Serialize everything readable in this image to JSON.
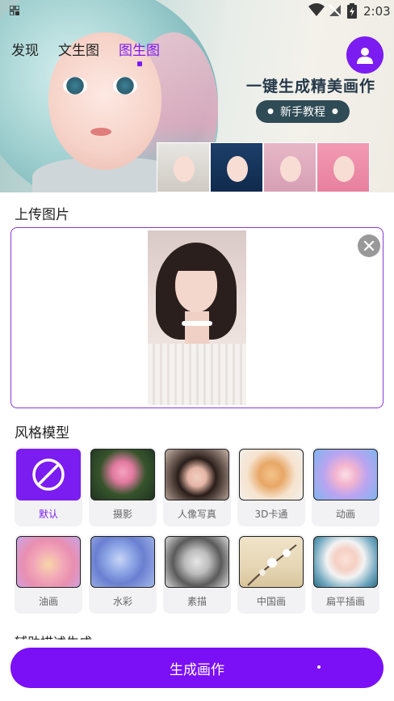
{
  "status_bar": {
    "time": "2:03"
  },
  "tabs": [
    {
      "label": "发现",
      "active": false
    },
    {
      "label": "文生图",
      "active": false
    },
    {
      "label": "图生图",
      "active": true
    }
  ],
  "banner": {
    "slogan": "一键生成精美画作",
    "tutorial_label": "新手教程"
  },
  "upload": {
    "title": "上传图片"
  },
  "styles_section": {
    "title": "风格模型",
    "items": [
      {
        "label": "默认",
        "selected": true,
        "icon": "ban-icon"
      },
      {
        "label": "摄影",
        "selected": false,
        "icon": "lotus-photo"
      },
      {
        "label": "人像写真",
        "selected": false,
        "icon": "portrait-photo"
      },
      {
        "label": "3D卡通",
        "selected": false,
        "icon": "hamster-3d"
      },
      {
        "label": "动画",
        "selected": false,
        "icon": "anime-girl"
      },
      {
        "label": "油画",
        "selected": false,
        "icon": "cat-oil"
      },
      {
        "label": "水彩",
        "selected": false,
        "icon": "hydrangea-watercolor"
      },
      {
        "label": "素描",
        "selected": false,
        "icon": "sketch-portrait"
      },
      {
        "label": "中国画",
        "selected": false,
        "icon": "chinese-painting"
      },
      {
        "label": "扁平插画",
        "selected": false,
        "icon": "flat-illustration"
      }
    ]
  },
  "hint_text": "辅助描述生成",
  "generate_button": {
    "label": "生成画作"
  },
  "colors": {
    "accent": "#7b1cf0",
    "button": "#7b0ff5"
  }
}
